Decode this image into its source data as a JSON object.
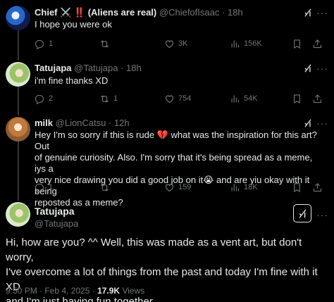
{
  "tweets": [
    {
      "name": "Chief ⚔️ ‼️ (Aliens are real)",
      "handle": "@ChiefofIsaac",
      "time": "18h",
      "text": "I hope you were ok",
      "stats": {
        "replies": "1",
        "reposts": "",
        "likes": "3K",
        "views": "156K"
      }
    },
    {
      "name": "Tatujapa",
      "handle": "@Tatujapa",
      "time": "18h",
      "text": "i'm fine thanks  XD",
      "stats": {
        "replies": "2",
        "reposts": "1",
        "likes": "754",
        "views": "54K"
      }
    },
    {
      "name": "milk",
      "handle": "@LionCatsu",
      "time": "12h",
      "text_lines": [
        "Hey I'm so sorry if this is rude 💔 what was the inspiration for this art? Out",
        "of genuine curiosity.  Also. I'm sorry that it's being spread as a meme, iys a",
        "very nice drawing you did a good job on it😭 and are yiu okay with it being",
        "reposted as a meme?"
      ],
      "stats": {
        "replies": "1",
        "reposts": "",
        "likes": "159",
        "views": "18K"
      }
    }
  ],
  "main": {
    "name": "Tatujapa",
    "handle": "@Tatujapa",
    "text_lines": [
      "Hi, how are you? ^^ Well, this was made as a vent art, but don't worry,",
      "I've overcome a lot of things from the past and today I'm fine with it XD",
      "and I'm just having fun together."
    ],
    "timestamp": "9:50 PM · Feb 4, 2025 · ",
    "views_count": "17.9K",
    "views_label": " Views"
  },
  "ui": {
    "separator": " · ",
    "more": "···",
    "icons": [
      "reply-icon",
      "repost-icon",
      "like-icon",
      "views-icon",
      "bookmark-icon",
      "share-icon",
      "grok-icon",
      "more-icon"
    ]
  }
}
